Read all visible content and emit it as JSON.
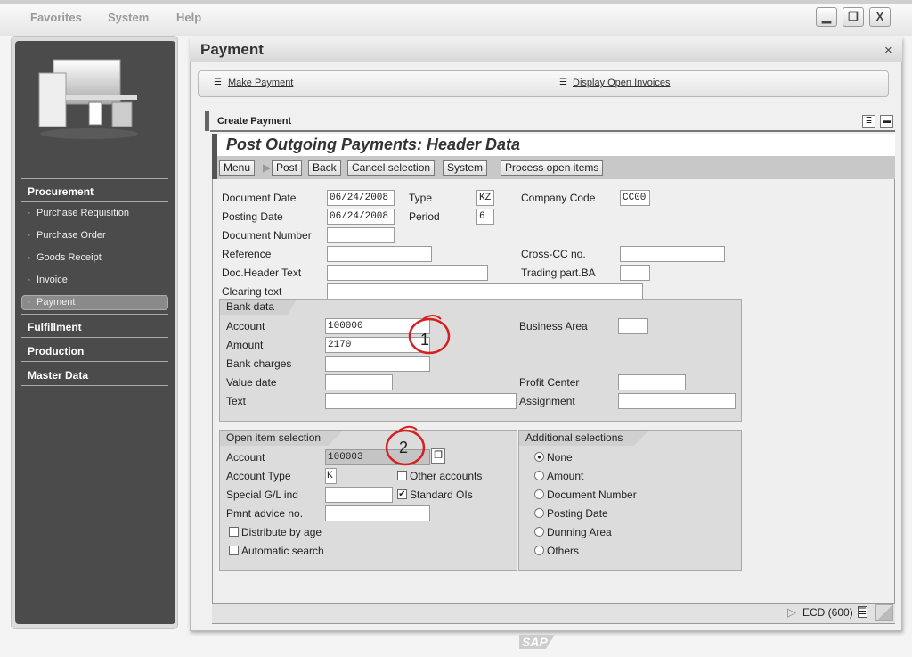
{
  "menu": [
    "Favorites",
    "System",
    "Help"
  ],
  "window_buttons": {
    "minimize": "▁",
    "restore": "❐",
    "close": "X"
  },
  "sidebar": {
    "sections": [
      {
        "label": "Procurement",
        "items": [
          "Purchase Requisition",
          "Purchase Order",
          "Goods Receipt",
          "Invoice",
          "Payment"
        ],
        "selected": "Payment"
      },
      {
        "label": "Fulfillment"
      },
      {
        "label": "Production"
      },
      {
        "label": "Master Data"
      }
    ]
  },
  "main": {
    "title": "Payment",
    "close": "×",
    "links": [
      "Make Payment",
      "Display Open Invoices"
    ],
    "section_title": "Create Payment"
  },
  "screen": {
    "title": "Post Outgoing Payments: Header Data",
    "toolbar": [
      "Menu",
      "Post",
      "Back",
      "Cancel selection",
      "System",
      "Process open items"
    ],
    "header": {
      "document_date": {
        "label": "Document Date",
        "value": "06/24/2008"
      },
      "type": {
        "label": "Type",
        "value": "KZ"
      },
      "company_code": {
        "label": "Company Code",
        "value": "CC00"
      },
      "posting_date": {
        "label": "Posting Date",
        "value": "06/24/2008"
      },
      "period": {
        "label": "Period",
        "value": "6"
      },
      "document_number": {
        "label": "Document Number",
        "value": ""
      },
      "reference": {
        "label": "Reference",
        "value": ""
      },
      "cross_cc": {
        "label": "Cross-CC no.",
        "value": ""
      },
      "doc_header_text": {
        "label": "Doc.Header Text",
        "value": ""
      },
      "trading_part": {
        "label": "Trading part.BA",
        "value": ""
      },
      "clearing_text": {
        "label": "Clearing text",
        "value": ""
      }
    },
    "bank": {
      "title": "Bank data",
      "account": {
        "label": "Account",
        "value": "100000"
      },
      "amount": {
        "label": "Amount",
        "value": "2170"
      },
      "bank_charges": {
        "label": "Bank charges",
        "value": ""
      },
      "value_date": {
        "label": "Value date",
        "value": ""
      },
      "text": {
        "label": "Text",
        "value": ""
      },
      "business_area": {
        "label": "Business Area",
        "value": ""
      },
      "profit_center": {
        "label": "Profit Center",
        "value": ""
      },
      "assignment": {
        "label": "Assignment",
        "value": ""
      }
    },
    "open_item": {
      "title": "Open item selection",
      "account": {
        "label": "Account",
        "value": "100003"
      },
      "account_type": {
        "label": "Account Type",
        "value": "K"
      },
      "special_gl": {
        "label": "Special G/L ind",
        "value": ""
      },
      "pmnt_advice": {
        "label": "Pmnt advice no.",
        "value": ""
      },
      "other_accounts": {
        "label": "Other accounts",
        "checked": false
      },
      "standard_ois": {
        "label": "Standard OIs",
        "checked": true
      },
      "distribute": {
        "label": "Distribute by age",
        "checked": false
      },
      "automatic": {
        "label": "Automatic search",
        "checked": false
      }
    },
    "additional": {
      "title": "Additional selections",
      "options": [
        "None",
        "Amount",
        "Document Number",
        "Posting Date",
        "Dunning Area",
        "Others"
      ],
      "selected": "None"
    },
    "annotations": [
      "1",
      "2"
    ],
    "annotation_color": "#d62020",
    "status": {
      "system": "ECD (600)"
    }
  },
  "footer_logo": "SAP"
}
